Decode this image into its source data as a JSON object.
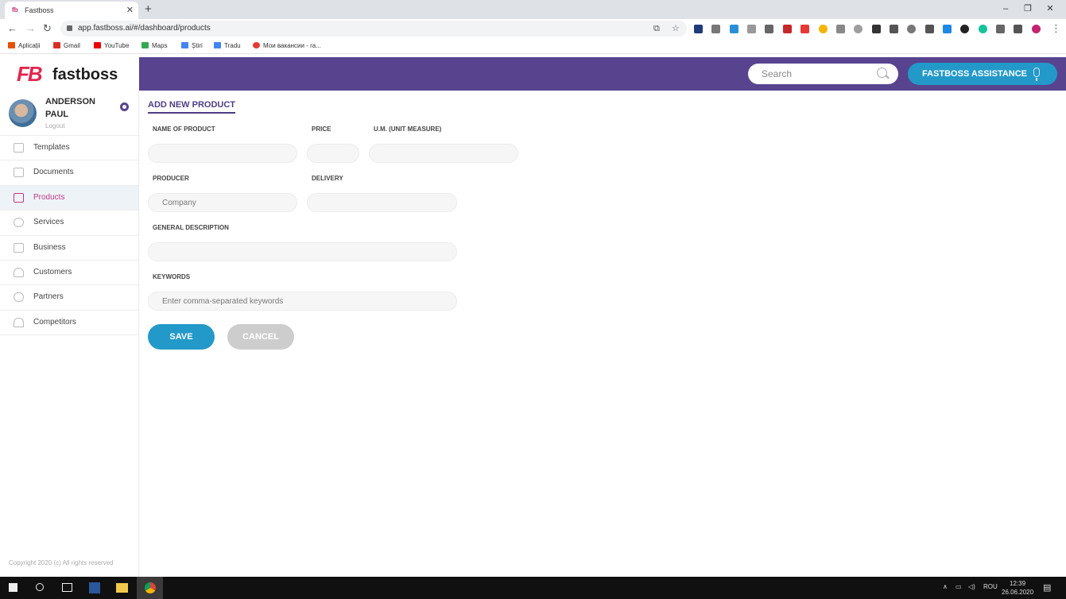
{
  "browser": {
    "tab_title": "Fastboss",
    "tab_favicon": "fb",
    "url": "app.fastboss.ai/#/dashboard/products",
    "bookmarks": [
      "Aplicații",
      "Gmail",
      "YouTube",
      "Maps",
      "Știri",
      "Tradu",
      "Мои вакансии - ra..."
    ]
  },
  "app": {
    "logo_mark": "FB",
    "logo_text": "fastboss",
    "search_placeholder": "Search",
    "assistant_label": "FASTBOSS ASSISTANCE",
    "accent_color": "#58438f",
    "button_color": "#2399c9"
  },
  "user": {
    "name": "ANDERSON PAUL",
    "logout": "Logout"
  },
  "sidebar": {
    "items": [
      {
        "label": "Templates",
        "icon": "table-icon"
      },
      {
        "label": "Documents",
        "icon": "document-icon"
      },
      {
        "label": "Products",
        "icon": "box-icon",
        "active": true
      },
      {
        "label": "Services",
        "icon": "services-icon"
      },
      {
        "label": "Business",
        "icon": "business-icon"
      },
      {
        "label": "Customers",
        "icon": "user-icon"
      },
      {
        "label": "Partners",
        "icon": "handshake-icon"
      },
      {
        "label": "Competitors",
        "icon": "competitors-icon"
      }
    ],
    "copyright": "Copyright 2020 (c) All rights reserved"
  },
  "form": {
    "title": "ADD NEW PRODUCT",
    "labels": {
      "name": "NAME OF PRODUCT",
      "price": "PRICE",
      "um": "U.M. (UNIT MEASURE)",
      "producer": "PRODUCER",
      "delivery": "DELIVERY",
      "description": "GENERAL DESCRIPTION",
      "keywords": "KEYWORDS"
    },
    "placeholders": {
      "producer": "Company",
      "keywords": "Enter comma-separated keywords"
    },
    "save_label": "SAVE",
    "cancel_label": "CANCEL"
  },
  "taskbar": {
    "language": "ROU",
    "time": "12:39",
    "date": "26.06.2020"
  }
}
